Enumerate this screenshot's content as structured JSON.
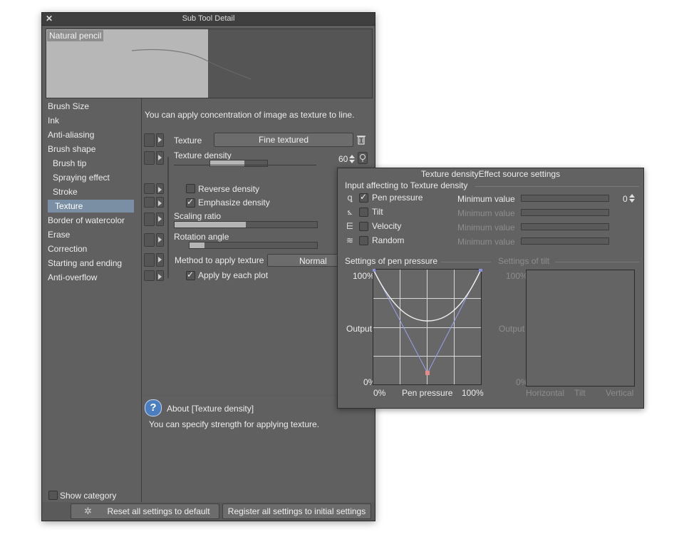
{
  "window": {
    "title": "Sub Tool Detail",
    "close_glyph": "✕",
    "preview_name": "Natural pencil"
  },
  "categories": [
    {
      "label": "Brush Size"
    },
    {
      "label": "Ink"
    },
    {
      "label": "Anti-aliasing"
    },
    {
      "label": "Brush shape"
    },
    {
      "label": "Brush tip"
    },
    {
      "label": "Spraying effect"
    },
    {
      "label": "Stroke"
    },
    {
      "label": "Texture"
    },
    {
      "label": "Border of watercolor"
    },
    {
      "label": "Erase"
    },
    {
      "label": "Correction"
    },
    {
      "label": "Starting and ending"
    },
    {
      "label": "Anti-overflow"
    }
  ],
  "settings": {
    "description": "You can apply concentration of image as texture to line.",
    "texture_label": "Texture",
    "texture_value": "Fine textured",
    "texture_density_label": "Texture density",
    "texture_density_value": "60",
    "texture_density_fraction": 0.6,
    "reverse_density_label": "Reverse density",
    "emphasize_density_label": "Emphasize density",
    "scaling_ratio_label": "Scaling ratio",
    "scaling_ratio_fraction": 0.5,
    "rotation_angle_label": "Rotation angle",
    "rotation_angle_fraction": 0.12,
    "method_label": "Method to apply texture",
    "method_value": "Normal",
    "apply_each_plot_label": "Apply by each plot"
  },
  "about": {
    "title": "About [Texture density]",
    "text": "You can specify strength for applying texture."
  },
  "bottom": {
    "show_category_label": "Show category",
    "reset_label": "Reset all settings to default",
    "register_label": "Register all settings to initial settings"
  },
  "effect_panel": {
    "title": "Texture densityEffect source settings",
    "section_label": "Input affecting to Texture density",
    "inputs": [
      {
        "label": "Pen pressure",
        "checked": true,
        "enabled": true
      },
      {
        "label": "Tilt",
        "checked": false,
        "enabled": false
      },
      {
        "label": "Velocity",
        "checked": false,
        "enabled": false
      },
      {
        "label": "Random",
        "checked": false,
        "enabled": false
      }
    ],
    "min_value_label": "Minimum value",
    "min_value": "0",
    "pressure_graph_title": "Settings of pen pressure",
    "tilt_graph_title": "Settings of tilt",
    "y_top": "100%",
    "y_mid": "Output",
    "y_bottom": "0%",
    "pressure_x_left": "0%",
    "pressure_x_mid": "Pen pressure",
    "pressure_x_right": "100%",
    "tilt_x_left": "Horizontal",
    "tilt_x_mid": "Tilt",
    "tilt_x_right": "Vertical"
  }
}
